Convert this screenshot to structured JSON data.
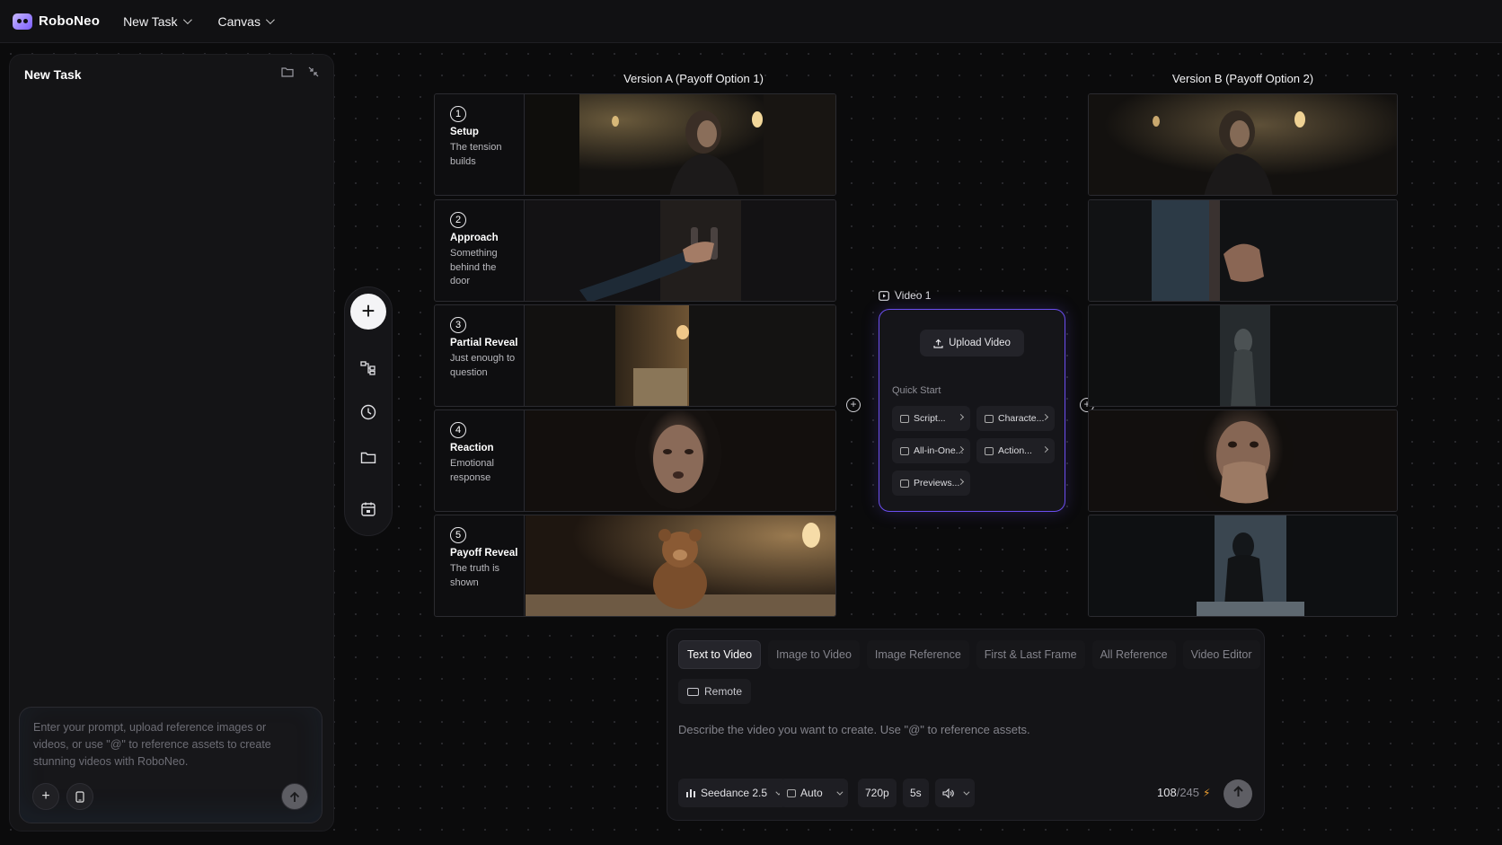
{
  "topbar": {
    "brand": "RoboNeo",
    "menus": [
      {
        "label": "New Task"
      },
      {
        "label": "Canvas"
      }
    ]
  },
  "left_panel": {
    "title": "New Task",
    "prompt_placeholder": "Enter your prompt, upload reference images or videos, or use \"@\" to reference assets to create stunning videos with RoboNeo."
  },
  "storyboard": {
    "version_a_title": "Version A (Payoff Option 1)",
    "version_b_title": "Version B (Payoff Option 2)",
    "steps": [
      {
        "number": "1",
        "title": "Setup",
        "desc": "The tension builds"
      },
      {
        "number": "2",
        "title": "Approach",
        "desc": "Something behind the door"
      },
      {
        "number": "3",
        "title": "Partial Reveal",
        "desc": "Just enough to question"
      },
      {
        "number": "4",
        "title": "Reaction",
        "desc": "Emotional response"
      },
      {
        "number": "5",
        "title": "Payoff Reveal",
        "desc": "The truth is shown"
      }
    ]
  },
  "video_node": {
    "label": "Video 1",
    "upload_label": "Upload Video",
    "quick_start_label": "Quick Start",
    "chips": [
      "Script...",
      "Characte...",
      "All-in-One...",
      "Action...",
      "Previews..."
    ]
  },
  "generator": {
    "tabs": [
      "Text to Video",
      "Image to Video",
      "Image Reference",
      "First & Last Frame",
      "All Reference",
      "Video Editor"
    ],
    "active_tab": "Text to Video",
    "remote_label": "Remote",
    "placeholder": "Describe the video you want to create. Use \"@\" to reference assets.",
    "model": "Seedance 2.5",
    "ratio": "Auto",
    "resolution": "720p",
    "duration": "5s",
    "credits_used": "108",
    "credits_total": "/245"
  },
  "colors": {
    "accent": "#6b4ef0",
    "background": "#0b0b0c",
    "panel": "#141416"
  }
}
